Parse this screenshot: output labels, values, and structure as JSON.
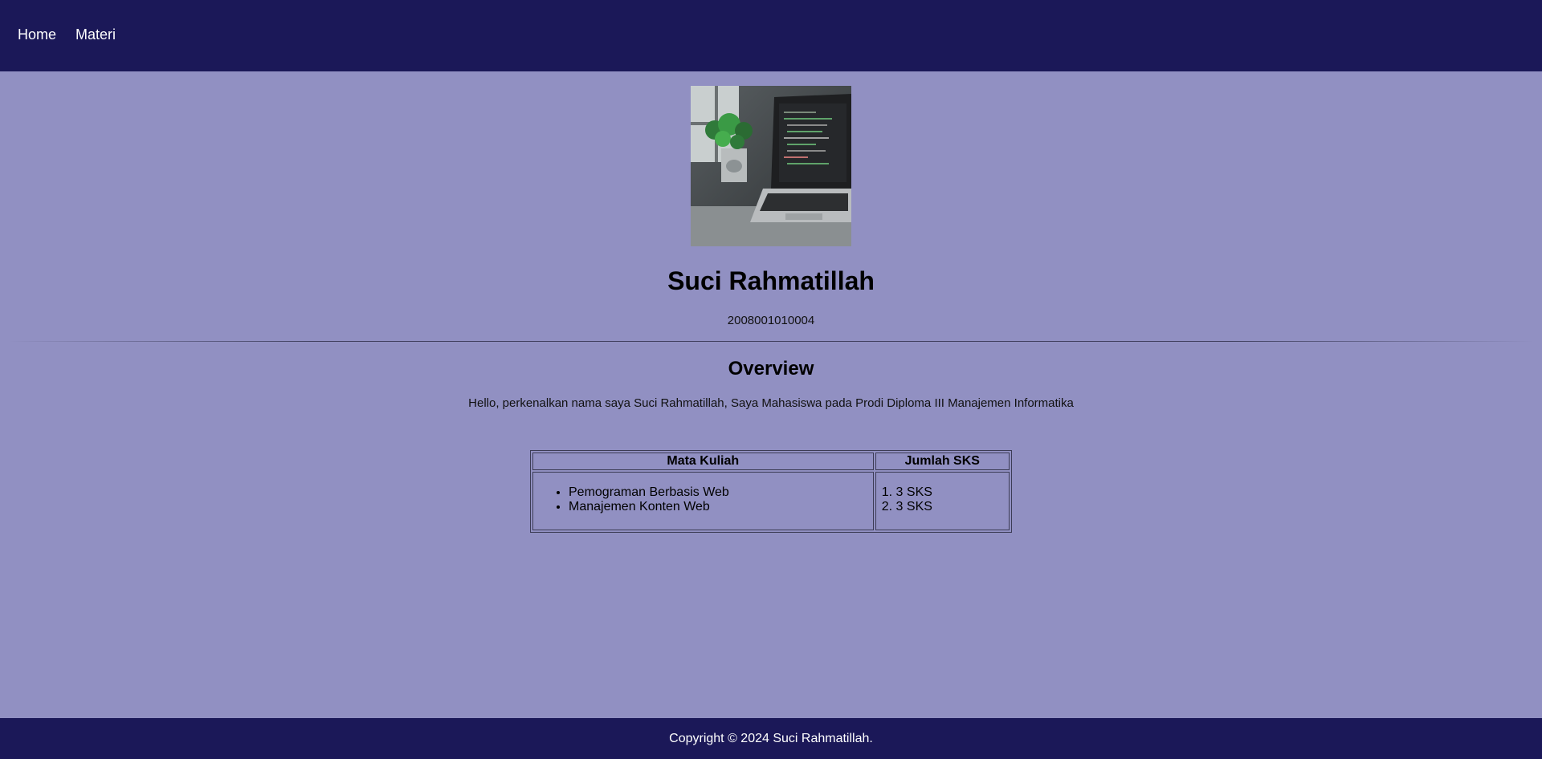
{
  "nav": {
    "items": [
      {
        "label": "Home"
      },
      {
        "label": "Materi"
      }
    ]
  },
  "profile": {
    "name": "Suci Rahmatillah",
    "nim": "2008001010004"
  },
  "overview": {
    "title": "Overview",
    "text": "Hello, perkenalkan nama saya Suci Rahmatillah, Saya Mahasiswa pada Prodi Diploma III Manajemen Informatika"
  },
  "table": {
    "headers": [
      "Mata Kuliah",
      "Jumlah SKS"
    ],
    "courses": [
      "Pemograman Berbasis Web",
      "Manajemen Konten Web"
    ],
    "sks": [
      "3 SKS",
      "3 SKS"
    ]
  },
  "footer": {
    "text": "Copyright © 2024 Suci Rahmatillah."
  },
  "colors": {
    "navbar": "#1b1858",
    "background": "#9190c2",
    "footer": "#1b1858"
  }
}
